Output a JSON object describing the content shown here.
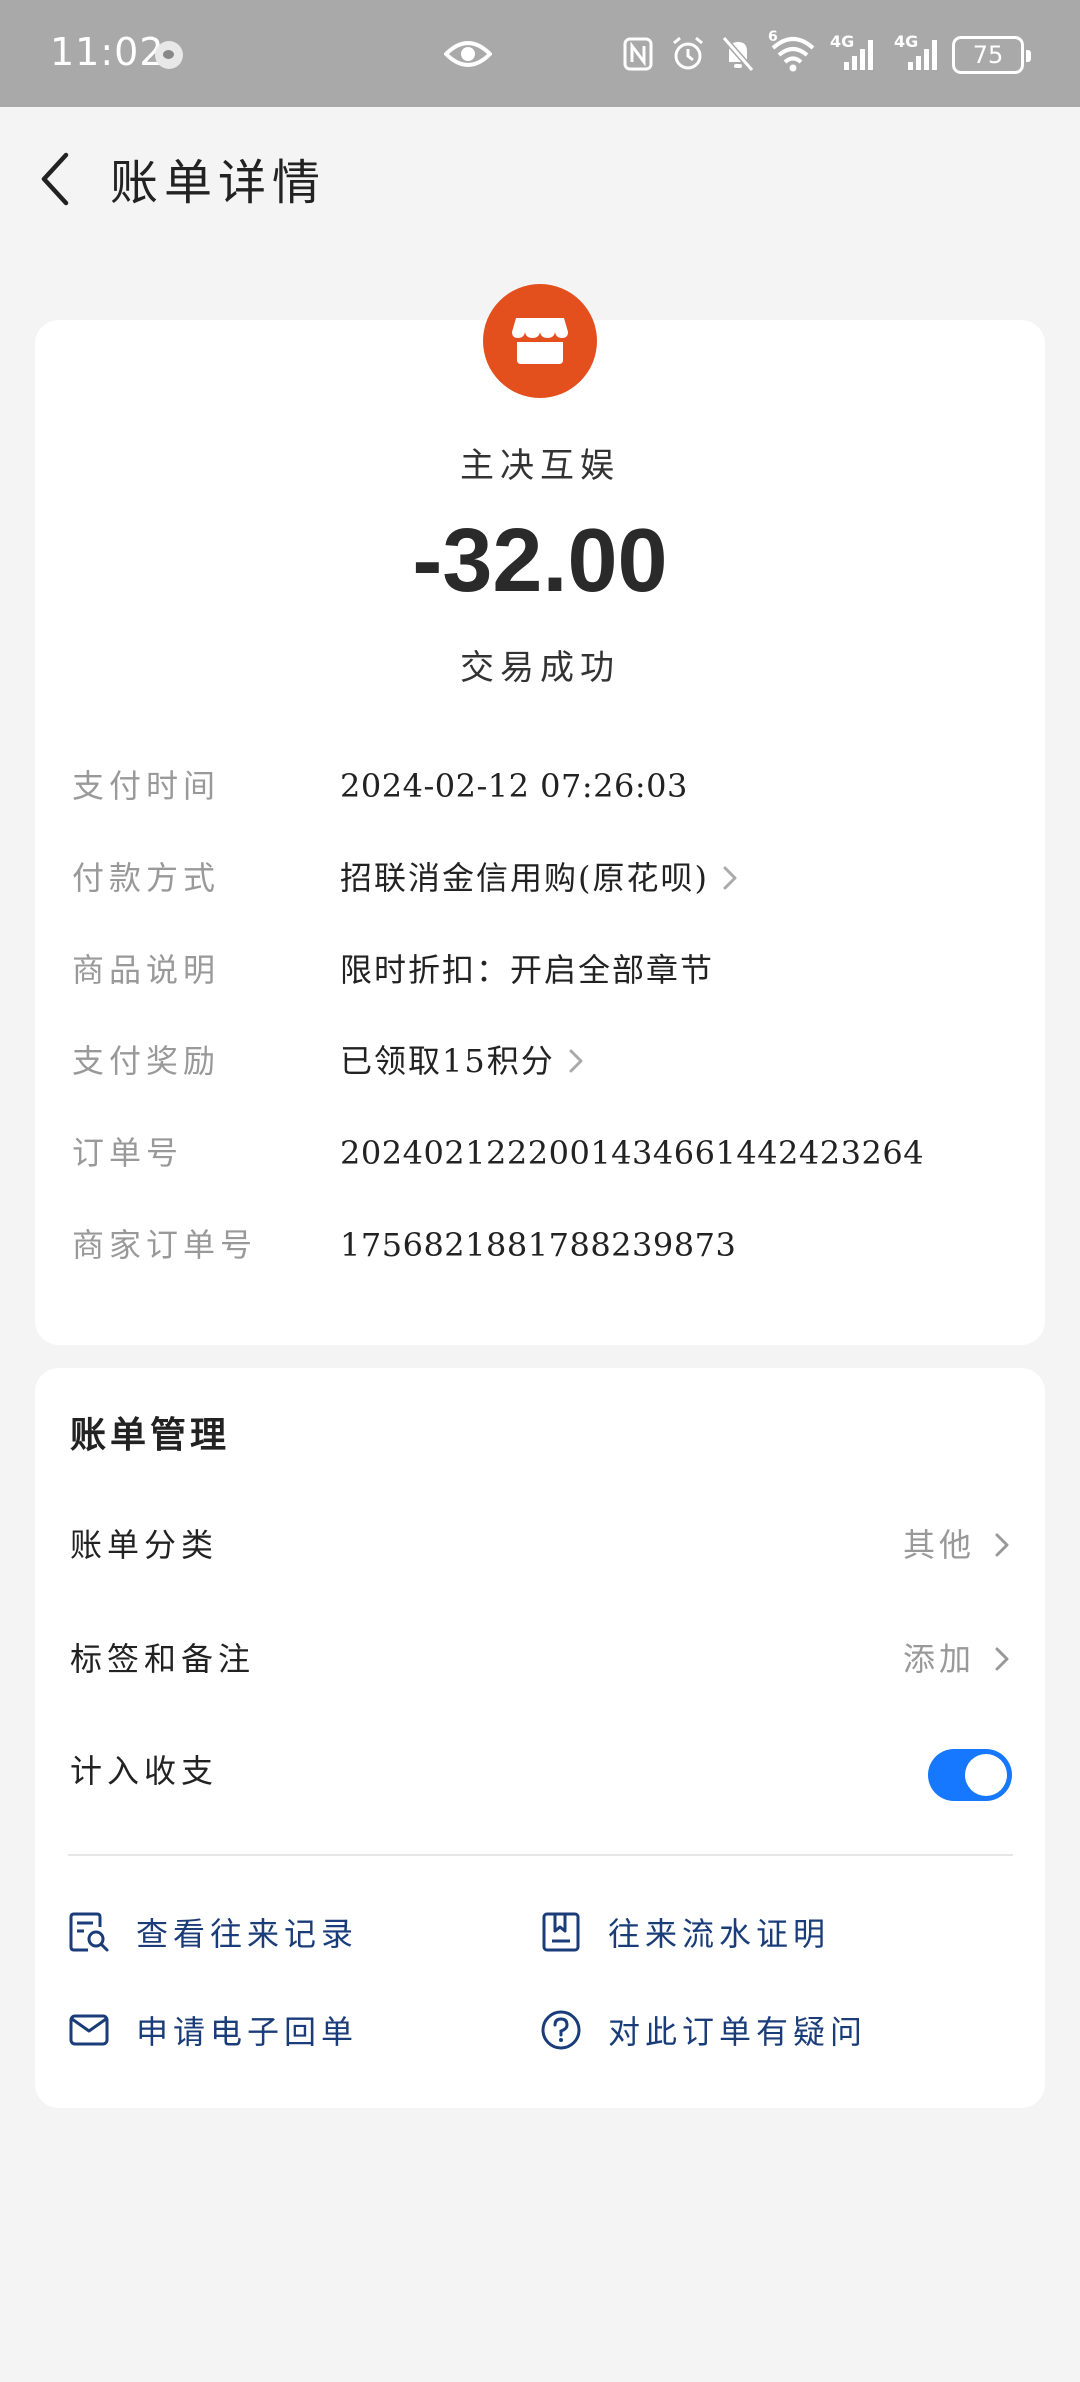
{
  "status_bar": {
    "time": "11:02",
    "battery": "75",
    "signal1": "4G",
    "signal2": "4G",
    "wifi_badge": "6"
  },
  "header": {
    "title": "账单详情"
  },
  "summary": {
    "merchant": "主决互娱",
    "amount": "-32.00",
    "status": "交易成功",
    "logo_color": "#e3501d"
  },
  "details": [
    {
      "label": "支付时间",
      "value": "2024-02-12 07:26:03"
    },
    {
      "label": "付款方式",
      "value": "招联消金信用购(原花呗)"
    },
    {
      "label": "商品说明",
      "value": "限时折扣：开启全部章节"
    },
    {
      "label": "支付奖励",
      "value": "已领取15积分"
    },
    {
      "label": "订单号",
      "value": "2024021222001434661442423264"
    },
    {
      "label": "商家订单号",
      "value": "1756821881788239873"
    }
  ],
  "management": {
    "title": "账单管理",
    "category_label": "账单分类",
    "category_value": "其他",
    "tags_label": "标签和备注",
    "tags_value": "添加",
    "include_label": "计入收支",
    "include_on": true,
    "accent": "#1677ff"
  },
  "links": {
    "records": "查看往来记录",
    "statement": "往来流水证明",
    "receipt": "申请电子回单",
    "question": "对此订单有疑问"
  }
}
